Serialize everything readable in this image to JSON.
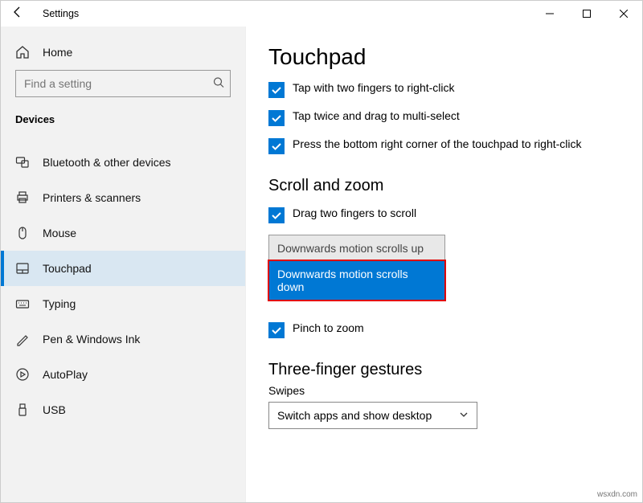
{
  "titlebar": {
    "title": "Settings"
  },
  "sidebar": {
    "home": "Home",
    "search_placeholder": "Find a setting",
    "section": "Devices",
    "items": [
      {
        "label": "Bluetooth & other devices"
      },
      {
        "label": "Printers & scanners"
      },
      {
        "label": "Mouse"
      },
      {
        "label": "Touchpad"
      },
      {
        "label": "Typing"
      },
      {
        "label": "Pen & Windows Ink"
      },
      {
        "label": "AutoPlay"
      },
      {
        "label": "USB"
      }
    ]
  },
  "content": {
    "title": "Touchpad",
    "checks": {
      "tap_two_finger": "Tap with two fingers to right-click",
      "tap_twice_drag": "Tap twice and drag to multi-select",
      "bottom_right": "Press the bottom right corner of the touchpad to right-click",
      "drag_two_scroll": "Drag two fingers to scroll",
      "pinch_zoom": "Pinch to zoom"
    },
    "scroll_zoom_heading": "Scroll and zoom",
    "scroll_dropdown": {
      "option_up": "Downwards motion scrolls up",
      "option_down": "Downwards motion scrolls down"
    },
    "three_finger_heading": "Three-finger gestures",
    "swipes_label": "Swipes",
    "swipes_value": "Switch apps and show desktop"
  },
  "watermark": "wsxdn.com"
}
